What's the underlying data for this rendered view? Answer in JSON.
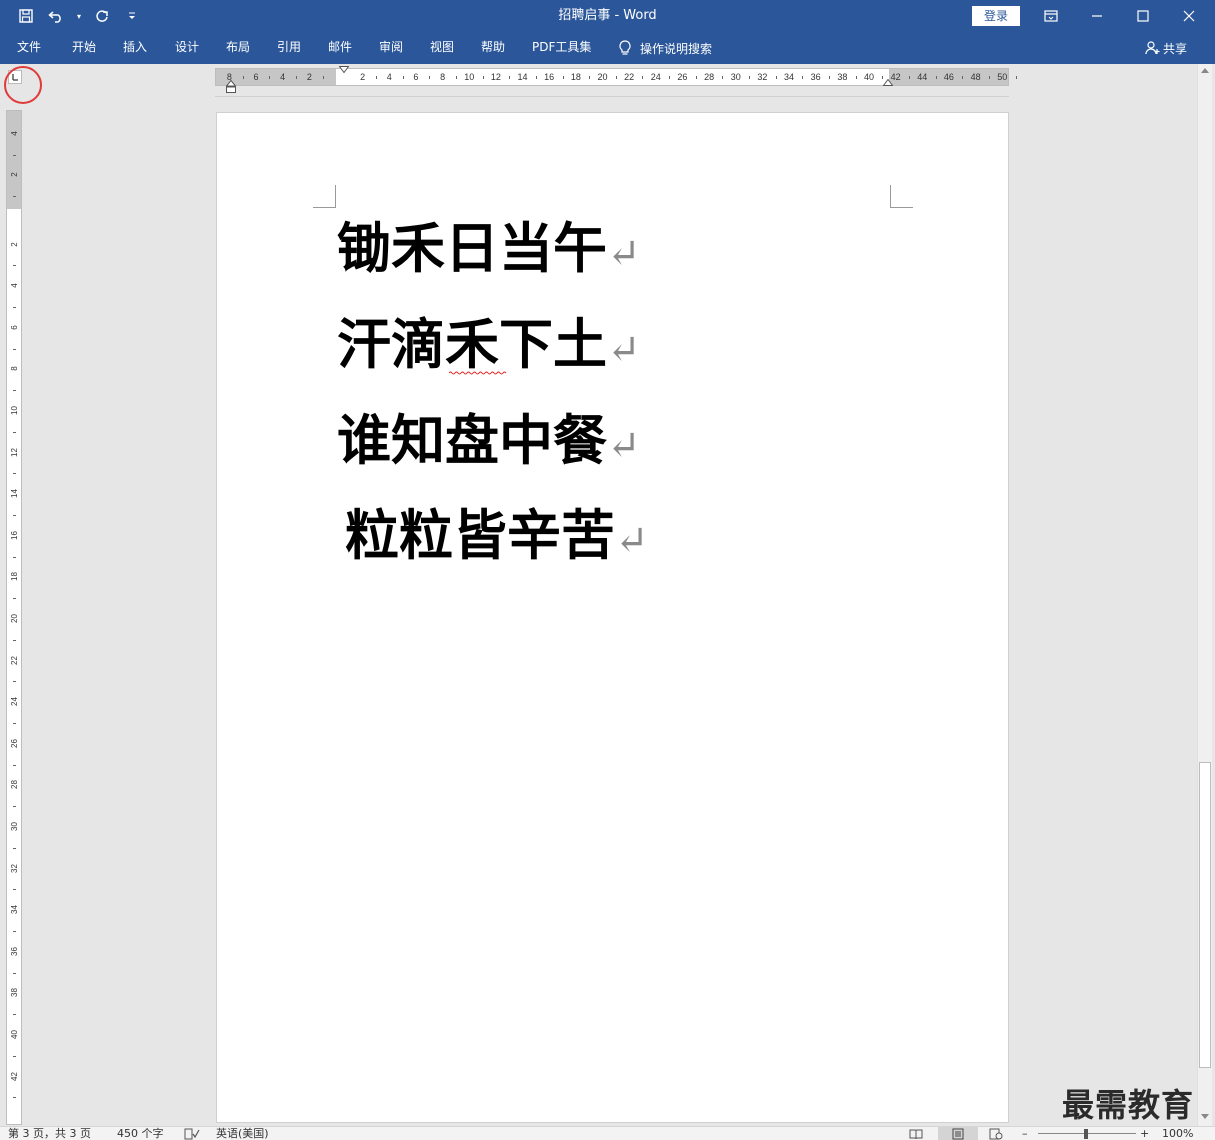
{
  "window": {
    "title": "招聘启事  -  Word",
    "login_label": "登录"
  },
  "ribbon": {
    "tabs": [
      "文件",
      "开始",
      "插入",
      "设计",
      "布局",
      "引用",
      "邮件",
      "审阅",
      "视图",
      "帮助",
      "PDF工具集"
    ],
    "tell_me": "操作说明搜索",
    "share": "共享"
  },
  "ruler": {
    "horizontal_left_labels": [
      "8",
      "6",
      "4",
      "2"
    ],
    "horizontal_labels": [
      "2",
      "4",
      "6",
      "8",
      "10",
      "12",
      "14",
      "16",
      "18",
      "20",
      "22",
      "24",
      "26",
      "28",
      "30",
      "32",
      "34",
      "36",
      "38",
      "40"
    ],
    "horizontal_right_labels": [
      "42",
      "44",
      "46",
      "48",
      "50"
    ],
    "vertical_top_labels": [
      "4",
      "2"
    ],
    "vertical_labels": [
      "2",
      "4",
      "6",
      "8",
      "10",
      "12",
      "14",
      "16",
      "18",
      "20",
      "22",
      "24",
      "26",
      "28",
      "30",
      "32",
      "34",
      "36",
      "38",
      "40",
      "42"
    ]
  },
  "document": {
    "lines": [
      "锄禾日当午",
      "汗滴禾下土",
      "谁知盘中餐",
      "粒粒皆辛苦"
    ],
    "paragraph_mark": "↵"
  },
  "status": {
    "page": "第 3 页，共 3 页",
    "words": "450 个字",
    "language": "英语(美国)",
    "zoom": "100%"
  },
  "watermark": "最需教育",
  "colors": {
    "ribbon_blue": "#2b579a",
    "highlight_circle": "#e03b3b"
  }
}
